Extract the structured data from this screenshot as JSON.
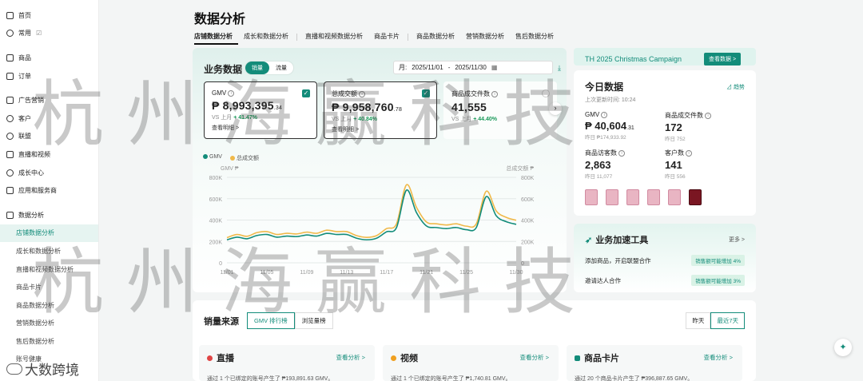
{
  "sidebar": {
    "items": [
      {
        "label": "首页",
        "icon": "home-icon"
      },
      {
        "label": "常用",
        "icon": "plus-circle-icon",
        "extra": "☑"
      },
      {
        "label": "商品",
        "icon": "box-icon"
      },
      {
        "label": "订单",
        "icon": "doc-icon"
      },
      {
        "label": "广告营销",
        "icon": "megaphone-icon"
      },
      {
        "label": "客户",
        "icon": "user-icon"
      },
      {
        "label": "联盟",
        "icon": "users-icon"
      },
      {
        "label": "直播和视频",
        "icon": "video-icon"
      },
      {
        "label": "成长中心",
        "icon": "growth-icon"
      },
      {
        "label": "应用和服务商",
        "icon": "apps-icon"
      },
      {
        "label": "数据分析",
        "icon": "chart-icon"
      }
    ],
    "sub_items": [
      "店铺数据分析",
      "成长和数据分析",
      "直播和视频数据分析",
      "商品卡片",
      "商品数据分析",
      "营销数据分析",
      "售后数据分析",
      "账号健康"
    ],
    "brand": "大数跨境"
  },
  "page": {
    "title": "数据分析"
  },
  "tabs": [
    "店铺数据分析",
    "成长和数据分析",
    "直播和视频数据分析",
    "商品卡片",
    "商品数据分析",
    "营销数据分析",
    "售后数据分析"
  ],
  "business": {
    "title": "业务数据",
    "toggle": [
      "销量",
      "流量"
    ],
    "date_prefix": "月:",
    "date_start": "2025/11/01",
    "date_sep": "-",
    "date_end": "2025/11/30",
    "cards": [
      {
        "label": "GMV",
        "value": "₱ 8,993,395",
        "decimals": ".34",
        "cmp_prefix": "VS 上月",
        "cmp": "+ 41.47%",
        "link": "查看明细 >"
      },
      {
        "label": "总成交额",
        "value": "₱ 9,958,760",
        "decimals": ".78",
        "cmp_prefix": "VS 上月",
        "cmp": "+ 40.84%",
        "link": "查看明细 >"
      },
      {
        "label": "商品成交件数",
        "value": "41,555",
        "decimals": "",
        "cmp_prefix": "VS 上月",
        "cmp": "+ 44.40%",
        "link": ""
      }
    ],
    "next": "›"
  },
  "chart_data": {
    "type": "line",
    "legend_position": "top-left",
    "grid": true,
    "x": [
      "11/01",
      "11/02",
      "11/03",
      "11/04",
      "11/05",
      "11/06",
      "11/07",
      "11/08",
      "11/09",
      "11/10",
      "11/11",
      "11/12",
      "11/13",
      "11/14",
      "11/15",
      "11/16",
      "11/17",
      "11/18",
      "11/19",
      "11/20",
      "11/21",
      "11/22",
      "11/23",
      "11/24",
      "11/25",
      "11/26",
      "11/27",
      "11/28",
      "11/29",
      "11/30"
    ],
    "x_ticks": [
      "11/01",
      "11/05",
      "11/09",
      "11/13",
      "11/17",
      "11/21",
      "11/25",
      "11/30"
    ],
    "left_axis_label": "GMV ₱",
    "right_axis_label": "总成交额 ₱",
    "left_ticks": [
      "0",
      "200K",
      "400K",
      "600K",
      "800K"
    ],
    "right_ticks": [
      "0",
      "200K",
      "400K",
      "600K",
      "800K"
    ],
    "ylim": [
      0,
      800000
    ],
    "series": [
      {
        "name": "GMV",
        "color": "#138c7a",
        "values": [
          215000,
          240000,
          225000,
          255000,
          265000,
          240000,
          250000,
          245000,
          260000,
          250000,
          275000,
          265000,
          265000,
          230000,
          215000,
          230000,
          290000,
          330000,
          680000,
          470000,
          345000,
          330000,
          320000,
          330000,
          310000,
          330000,
          620000,
          440000,
          385000,
          360000
        ]
      },
      {
        "name": "总成交额",
        "color": "#f0b94a",
        "values": [
          235000,
          265000,
          248000,
          282000,
          292000,
          265000,
          276000,
          270000,
          287000,
          276000,
          305000,
          292000,
          292000,
          254000,
          238000,
          254000,
          320000,
          365000,
          730000,
          520000,
          382000,
          365000,
          354000,
          365000,
          343000,
          365000,
          670000,
          485000,
          425000,
          398000
        ]
      }
    ]
  },
  "campaign": {
    "title": "TH 2025 Christmas Campaign",
    "button": "查看数据 >"
  },
  "today": {
    "title": "今日数据",
    "updated": "上次更新时间: 10:24",
    "trend": "趋势",
    "metrics": [
      {
        "label": "GMV",
        "value": "₱ 40,604",
        "decimals": ".31",
        "prev": "昨日 ₱174,933.92"
      },
      {
        "label": "商品成交件数",
        "value": "172",
        "decimals": "",
        "prev": "昨日 752"
      },
      {
        "label": "商品访客数",
        "value": "2,863",
        "decimals": "",
        "prev": "昨日 11,077"
      },
      {
        "label": "客户数",
        "value": "141",
        "decimals": "",
        "prev": "昨日 556"
      }
    ]
  },
  "accel": {
    "title": "业务加速工具",
    "more": "更多 >",
    "rows": [
      {
        "label": "添加商品，开启联盟合作",
        "badge": "销售额可能增加 4%"
      },
      {
        "label": "邀请达人合作",
        "badge": "销售额可能增加 3%"
      }
    ]
  },
  "sales_source": {
    "title": "销量来源",
    "tabs": [
      "GMV 排行榜",
      "浏览量榜"
    ],
    "periods": [
      "昨天",
      "最近7天"
    ],
    "cards": [
      {
        "title": "直播",
        "link": "查看分析 >",
        "desc": "通过 1 个已绑定的账号产生了 ₱193,891.63 GMV。",
        "color": "#e04545"
      },
      {
        "title": "视频",
        "link": "查看分析 >",
        "desc": "通过 1 个已绑定的账号产生了 ₱1,740.81 GMV。",
        "color": "#f0a020"
      },
      {
        "title": "商品卡片",
        "link": "查看分析 >",
        "desc": "通过 20 个商品卡片产生了 ₱396,887.65 GMV。",
        "color": "#138c7a"
      }
    ]
  },
  "watermark": "杭州海赢科技"
}
